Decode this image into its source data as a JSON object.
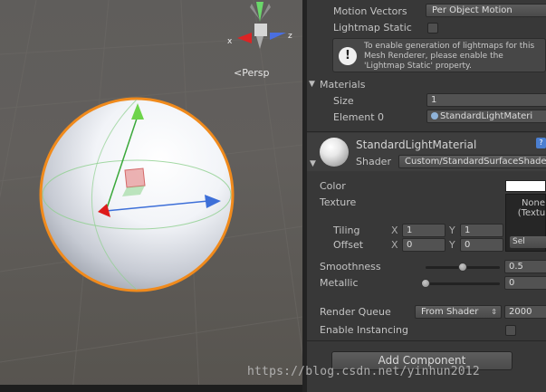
{
  "scene": {
    "persp_label": "Persp",
    "gizmo_axes": {
      "x": "x",
      "z": "z"
    }
  },
  "inspector": {
    "motion_vectors": {
      "label": "Motion Vectors",
      "value": "Per Object Motion"
    },
    "lightmap_static": {
      "label": "Lightmap Static",
      "checked": false
    },
    "help_box": {
      "text": "To enable generation of lightmaps for this\nMesh Renderer, please enable the\n'Lightmap Static' property."
    },
    "materials": {
      "label": "Materials",
      "size_label": "Size",
      "size_value": "1",
      "element0_label": "Element 0",
      "element0_value": "StandardLightMateri"
    },
    "material": {
      "name": "StandardLightMaterial",
      "shader_label": "Shader",
      "shader_value": "Custom/StandardSurfaceShade"
    },
    "color": {
      "label": "Color",
      "value": "#ffffff"
    },
    "texture": {
      "label": "Texture",
      "none_label": "None\n(Textur",
      "select_label": "Sel"
    },
    "tiling": {
      "label": "Tiling",
      "x_label": "X",
      "x": "1",
      "y_label": "Y",
      "y": "1"
    },
    "offset": {
      "label": "Offset",
      "x_label": "X",
      "x": "0",
      "y_label": "Y",
      "y": "0"
    },
    "smoothness": {
      "label": "Smoothness",
      "value": "0.5",
      "fraction": 0.5
    },
    "metallic": {
      "label": "Metallic",
      "value": "0",
      "fraction": 0.0
    },
    "render_queue": {
      "label": "Render Queue",
      "dropdown": "From Shader",
      "value": "2000"
    },
    "enable_instancing": {
      "label": "Enable Instancing",
      "checked": false
    },
    "add_component_label": "Add Component"
  },
  "watermark": "https://blog.csdn.net/yinhun2012"
}
